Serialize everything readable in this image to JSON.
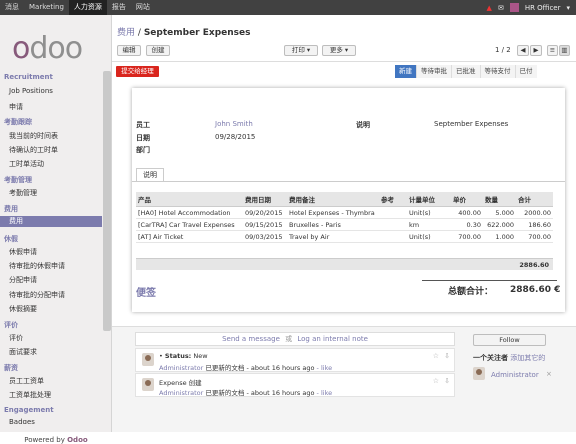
{
  "topbar": {
    "menus": [
      "消息",
      "Marketing",
      "人力资源",
      "报告",
      "网站"
    ],
    "active_index": 2,
    "user": "HR Officer"
  },
  "sidebar": {
    "logo": "odoo",
    "sections": [
      {
        "title": "Recruitment",
        "items": [
          "Job Positions",
          "申请"
        ]
      },
      {
        "title": "考勤跟踪",
        "items": [
          "我当前的时间表",
          "待确认的工时单",
          "工时单活动"
        ]
      },
      {
        "title": "考勤管理",
        "items": [
          "考勤管理"
        ]
      },
      {
        "title": "费用",
        "items": [
          "费用"
        ]
      },
      {
        "title": "休假",
        "items": [
          "休假申请",
          "待审批的休假申请",
          "分配申请",
          "待审批的分配申请",
          "休假摘要"
        ]
      },
      {
        "title": "评价",
        "items": [
          "评价",
          "面试要求"
        ]
      },
      {
        "title": "薪资",
        "items": [
          "员工工资单",
          "工资单批处理"
        ]
      },
      {
        "title": "Engagement",
        "items": [
          "Badges"
        ]
      }
    ],
    "active_item": "费用",
    "powered_by": "Powered by",
    "powered_brand": "Odoo"
  },
  "breadcrumb": {
    "parent": "费用",
    "separator": "/",
    "current": "September Expenses"
  },
  "toolbar": {
    "edit": "编辑",
    "create": "创建",
    "print": "打印",
    "more": "更多",
    "pager": "1 / 2"
  },
  "actions": {
    "submit": "提交给经理"
  },
  "statusbar": [
    "新建",
    "等待审批",
    "已批准",
    "等待支付",
    "已付"
  ],
  "form": {
    "employee_label": "员工",
    "employee": "John Smith",
    "description_label": "说明",
    "description": "September Expenses",
    "date_label": "日期",
    "date": "09/28/2015",
    "department_label": "部门"
  },
  "tab": "说明",
  "lines": {
    "headers": [
      "产品",
      "费用日期",
      "费用备注",
      "参考",
      "计量单位",
      "单价",
      "数量",
      "合计"
    ],
    "rows": [
      [
        "[HA0] Hotel Accommodation",
        "09/20/2015",
        "Hotel Expenses - Thymbra",
        "",
        "Unit(s)",
        "400.00",
        "5.000",
        "2000.00"
      ],
      [
        "[CarTRA] Car Travel Expenses",
        "09/15/2015",
        "Bruxelles - Paris",
        "",
        "km",
        "0.30",
        "622.000",
        "186.60"
      ],
      [
        "[AT] Air Ticket",
        "09/03/2015",
        "Travel by Air",
        "",
        "Unit(s)",
        "700.00",
        "1.000",
        "700.00"
      ]
    ],
    "subtotal": "2886.60"
  },
  "notes": "便签",
  "total": {
    "label": "总额合计：",
    "value": "2886.60 €"
  },
  "chatter": {
    "send_message": "Send a message",
    "or": "或",
    "log_note": "Log an internal note",
    "messages": [
      {
        "prefix": "• ",
        "status_label": "Status:",
        "status": "New",
        "author": "Administrator",
        "action": "已更新的文档",
        "time": "- about 16 hours ago",
        "like": "- like"
      },
      {
        "body": "Expense 创建",
        "author": "Administrator",
        "action": "已更新的文档",
        "time": "- about 16 hours ago",
        "like": "- like"
      }
    ],
    "follow": "Follow",
    "followers_label": "一个关注者",
    "add_others": "添加其它的",
    "follower": "Administrator"
  },
  "colors": {
    "brand": "#7c7bad",
    "topbar": "#414141",
    "status_active": "#4176c1",
    "submit": "#d9251d"
  }
}
